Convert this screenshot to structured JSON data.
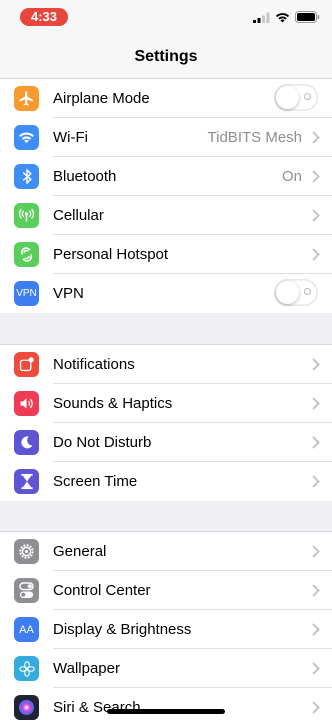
{
  "status": {
    "time": "4:33"
  },
  "nav": {
    "title": "Settings"
  },
  "groups": [
    {
      "rows": [
        {
          "label": "Airplane Mode",
          "color": "#f79a2f",
          "icon": "airplane-icon",
          "toggle": "off"
        },
        {
          "label": "Wi-Fi",
          "value": "TidBITS Mesh",
          "color": "#3f8ef5",
          "icon": "wifi-icon"
        },
        {
          "label": "Bluetooth",
          "value": "On",
          "color": "#3f8ef5",
          "icon": "bluetooth-icon"
        },
        {
          "label": "Cellular",
          "color": "#5ace5a",
          "icon": "cellular-icon"
        },
        {
          "label": "Personal Hotspot",
          "color": "#5ace5a",
          "icon": "hotspot-icon"
        },
        {
          "label": "VPN",
          "color": "#3f7ef0",
          "icon": "vpn-icon",
          "icon_text": "VPN",
          "toggle": "off"
        }
      ]
    },
    {
      "rows": [
        {
          "label": "Notifications",
          "color": "#ef4b3d",
          "icon": "notifications-icon"
        },
        {
          "label": "Sounds & Haptics",
          "color": "#ef3b56",
          "icon": "speaker-icon"
        },
        {
          "label": "Do Not Disturb",
          "color": "#5d55d3",
          "icon": "moon-icon"
        },
        {
          "label": "Screen Time",
          "color": "#5d55d3",
          "icon": "hourglass-icon"
        }
      ]
    },
    {
      "rows": [
        {
          "label": "General",
          "color": "#8e8e93",
          "icon": "gear-icon"
        },
        {
          "label": "Control Center",
          "color": "#8e8e93",
          "icon": "toggles-icon"
        },
        {
          "label": "Display & Brightness",
          "color": "#3f7ef0",
          "icon": "display-icon",
          "icon_text": "AA"
        },
        {
          "label": "Wallpaper",
          "color": "#35aadc",
          "icon": "flower-icon"
        },
        {
          "label": "Siri & Search",
          "color": "#222233",
          "icon": "siri-icon"
        }
      ]
    }
  ]
}
